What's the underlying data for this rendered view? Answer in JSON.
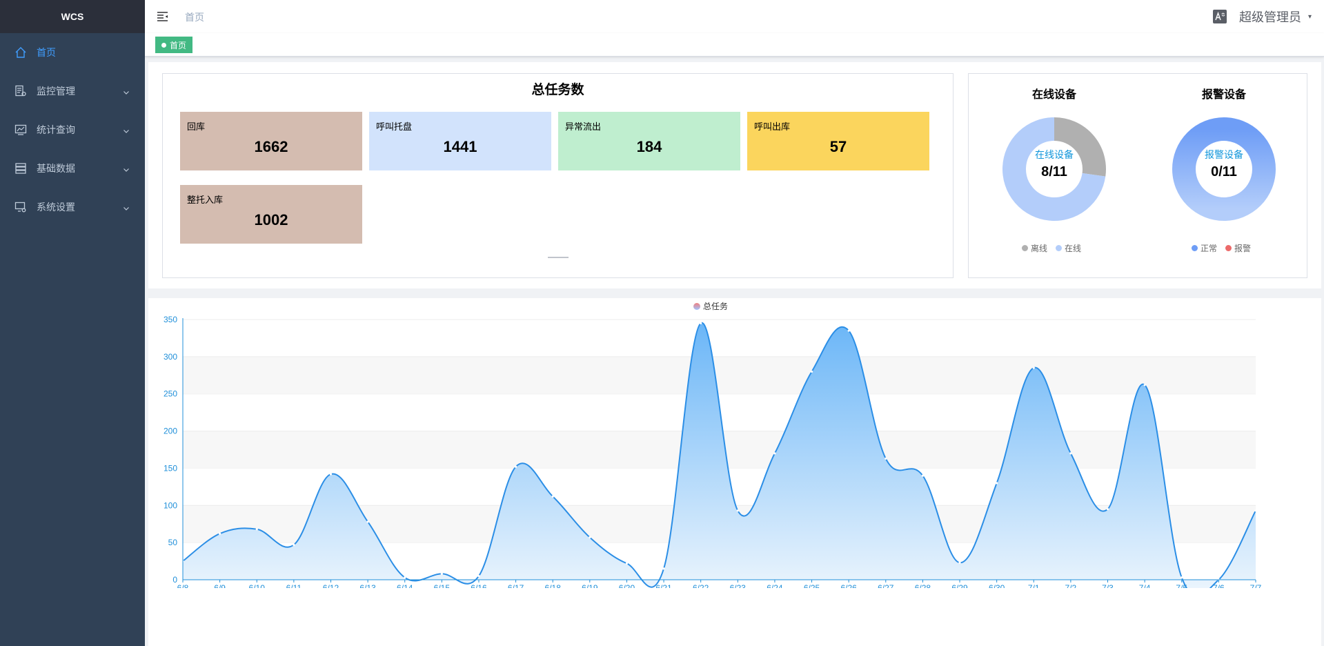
{
  "app": {
    "logo": "WCS"
  },
  "sidebar": {
    "items": [
      {
        "label": "首页",
        "icon": "home-icon",
        "active": true
      },
      {
        "label": "监控管理",
        "icon": "monitor-document-icon"
      },
      {
        "label": "统计查询",
        "icon": "chart-icon"
      },
      {
        "label": "基础数据",
        "icon": "database-icon"
      },
      {
        "label": "系统设置",
        "icon": "settings-icon"
      }
    ]
  },
  "navbar": {
    "breadcrumb": "首页",
    "username": "超级管理员",
    "caret": "▾"
  },
  "tags": {
    "active_tag": "首页"
  },
  "tasks": {
    "title": "总任务数",
    "stats": [
      {
        "label": "回库",
        "value": "1662",
        "color": "#d4bcb0"
      },
      {
        "label": "呼叫托盘",
        "value": "1441",
        "color": "#d2e3fc"
      },
      {
        "label": "异常流出",
        "value": "184",
        "color": "#bfeecf"
      },
      {
        "label": "呼叫出库",
        "value": "57",
        "color": "#fbd55d"
      },
      {
        "label": "整托入库",
        "value": "1002",
        "color": "#d4bcb0"
      }
    ]
  },
  "devices": {
    "online": {
      "title": "在线设备",
      "center_label": "在线设备",
      "center_value": "8/11",
      "online_fraction": 0.7273,
      "legend": [
        {
          "label": "离线",
          "color": "#b0b0b0"
        },
        {
          "label": "在线",
          "color": "#b3cdfa"
        }
      ]
    },
    "alarm": {
      "title": "报警设备",
      "center_label": "报警设备",
      "center_value": "0/11",
      "alarm_fraction": 0,
      "legend": [
        {
          "label": "正常",
          "color": "#6e9df6"
        },
        {
          "label": "报警",
          "color": "#ec6a6a"
        }
      ]
    }
  },
  "chart_data": {
    "type": "area",
    "series": [
      {
        "name": "总任务",
        "values": [
          25,
          62,
          68,
          47,
          142,
          78,
          3,
          8,
          5,
          152,
          112,
          57,
          22,
          15,
          345,
          93,
          170,
          280,
          335,
          163,
          140,
          23,
          130,
          285,
          170,
          95,
          262,
          3,
          0,
          93
        ]
      }
    ],
    "x": [
      "6/8",
      "6/9",
      "6/10",
      "6/11",
      "6/12",
      "6/13",
      "6/14",
      "6/15",
      "6/16",
      "6/17",
      "6/18",
      "6/19",
      "6/20",
      "6/21",
      "6/22",
      "6/23",
      "6/24",
      "6/25",
      "6/26",
      "6/27",
      "6/28",
      "6/29",
      "6/30",
      "7/1",
      "7/2",
      "7/3",
      "7/4",
      "7/5",
      "7/6",
      "7/7"
    ],
    "y_ticks": [
      0,
      50,
      100,
      150,
      200,
      250,
      300,
      350
    ],
    "ylim": [
      0,
      350
    ],
    "colors": {
      "line": "#2b8ee6",
      "area_top": "#6bb6f7",
      "area_bottom": "#eef6fd",
      "axis": "#1f8fd9",
      "band": "#f7f7f7"
    }
  }
}
